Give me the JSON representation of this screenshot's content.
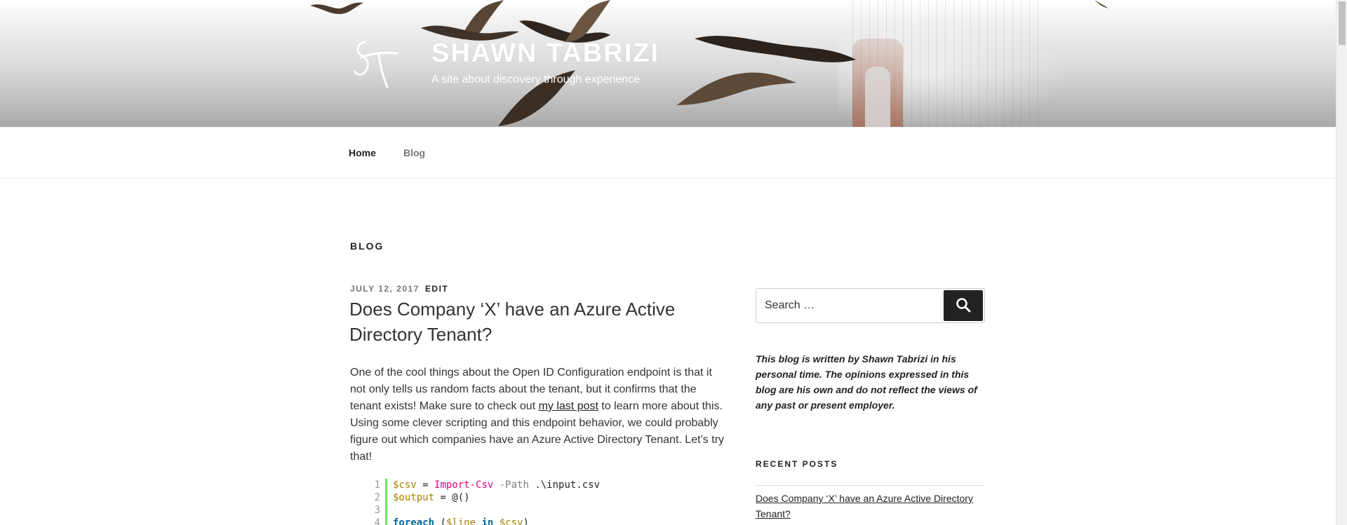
{
  "site": {
    "title": "SHAWN TABRIZI",
    "description": "A site about discovery through experience"
  },
  "nav": {
    "items": [
      {
        "label": "Home"
      },
      {
        "label": "Blog"
      }
    ]
  },
  "main": {
    "page_title": "BLOG",
    "post": {
      "date": "JULY 12, 2017",
      "edit_label": "EDIT",
      "title": "Does Company ‘X’ have an Azure Active Directory Tenant?",
      "body_before_link": "One of the cool things about the Open ID Configuration endpoint is that it not only tells us random facts about the tenant, but it confirms that the tenant exists! Make sure to check out ",
      "link_text": "my last post",
      "body_after_link": " to learn more about this. Using some clever scripting and this endpoint behavior, we could probably figure out which companies have an Azure Active Directory Tenant. Let’s try that!",
      "code": {
        "line_numbers": [
          "1",
          "2",
          "3",
          "4"
        ],
        "line1": {
          "var": "$csv",
          "eq": " = ",
          "cmd": "Import-Csv",
          "param": " -Path",
          "rest": " .\\input.csv"
        },
        "line2": {
          "var": "$output",
          "rest": " = @()"
        },
        "line4": {
          "kw": "foreach",
          "open": " (",
          "var1": "$line",
          "kw2": " in ",
          "var2": "$csv",
          "close": ")"
        }
      }
    }
  },
  "sidebar": {
    "search_placeholder": "Search …",
    "disclaimer": "This blog is written by Shawn Tabrizi in his personal time. The opinions expressed in this blog are his own and do not reflect the views of any past or present employer.",
    "recent_posts_title": "RECENT POSTS",
    "recent_posts": [
      {
        "title": "Does Company ‘X’ have an Azure Active Directory Tenant?"
      }
    ]
  },
  "colors": {
    "accent_dark": "#222222",
    "code_bar": "#6ce26c"
  },
  "icons": {
    "search": "search-icon",
    "logo": "signature-logo"
  }
}
